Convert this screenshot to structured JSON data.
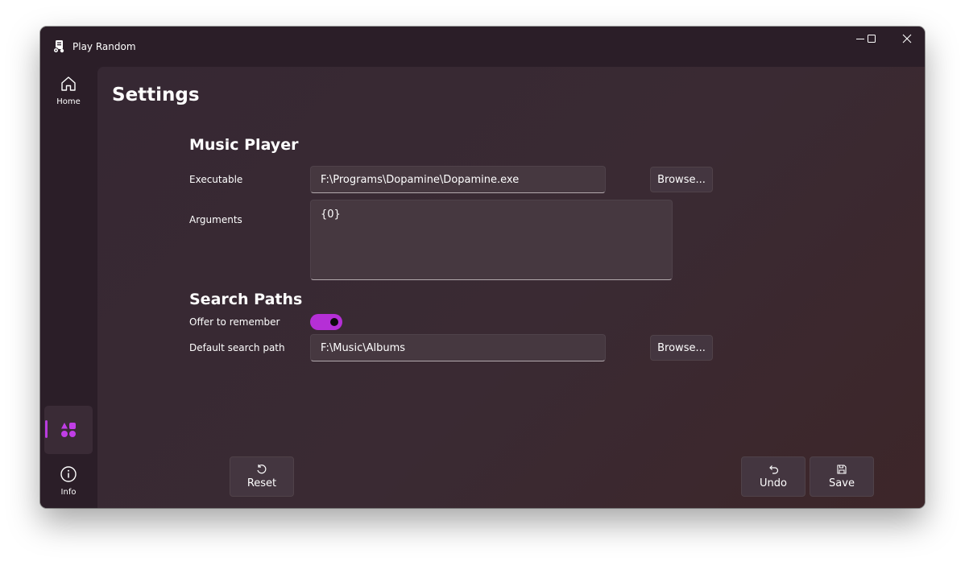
{
  "window": {
    "title": "Play Random"
  },
  "sidebar": {
    "items": [
      {
        "label": "Home",
        "icon": "home-icon"
      },
      {
        "label": "",
        "icon": "shapes-icon",
        "selected": true
      },
      {
        "label": "Info",
        "icon": "info-icon"
      }
    ]
  },
  "page": {
    "title": "Settings"
  },
  "music_player": {
    "section_title": "Music Player",
    "executable_label": "Executable",
    "executable_value": "F:\\Programs\\Dopamine\\Dopamine.exe",
    "browse_label": "Browse...",
    "arguments_label": "Arguments",
    "arguments_value": "{0}"
  },
  "search_paths": {
    "section_title": "Search Paths",
    "offer_label": "Offer to remember",
    "offer_enabled": true,
    "default_path_label": "Default search path",
    "default_path_value": "F:\\Music\\Albums",
    "browse_label": "Browse..."
  },
  "commands": {
    "reset_label": "Reset",
    "undo_label": "Undo",
    "save_label": "Save"
  },
  "colors": {
    "accent": "#b52fd6",
    "window_bg": "#2b1e28"
  }
}
